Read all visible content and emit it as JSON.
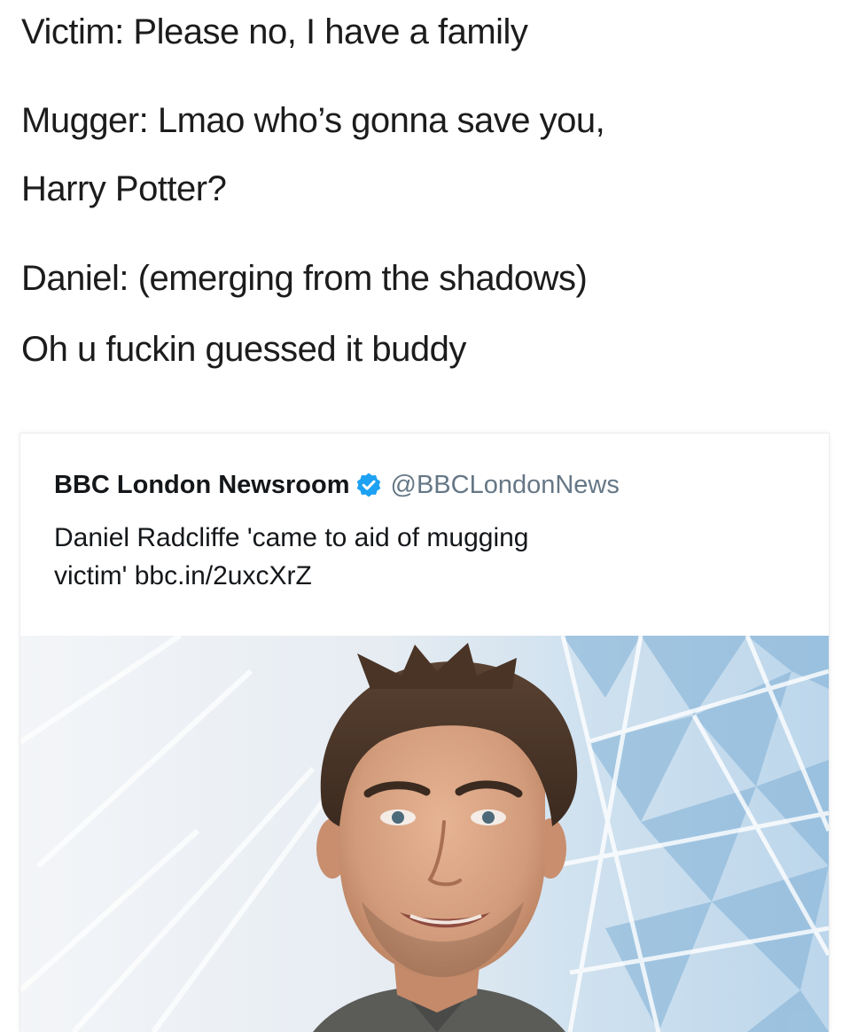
{
  "caption": {
    "line1": "Victim: Please no, I have a family",
    "line2": "Mugger: Lmao who’s gonna save you,",
    "line3": "Harry Potter?",
    "line4": "Daniel: (emerging from the shadows)",
    "line5": "Oh u fuckin guessed it buddy"
  },
  "tweet": {
    "author": "BBC London Newsroom",
    "handle": "@BBCLondonNews",
    "text_line1": "Daniel Radcliffe 'came to aid of mugging",
    "text_line2": "victim' bbc.in/2uxcXrZ",
    "verified_icon": "verified-badge-icon",
    "verified_color": "#1da1f2"
  },
  "photo": {
    "subject": "man-portrait",
    "background_color": "#cfe0ee",
    "pattern_color": "#6fa6cf"
  }
}
